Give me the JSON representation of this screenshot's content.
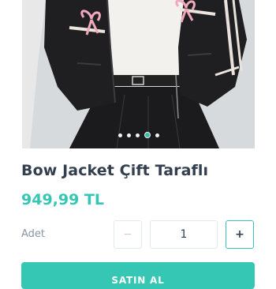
{
  "product": {
    "image_icon": "leather-jacket-photo",
    "gallery_dots": 5,
    "gallery_active_index": 3,
    "title": "Bow Jacket Çift Taraflı",
    "price": "949,99 TL"
  },
  "quantity": {
    "label": "Adet",
    "minus_label": "−",
    "value": "1",
    "plus_label": "+"
  },
  "actions": {
    "buy_label": "SATIN AL"
  },
  "colors": {
    "accent": "#35c7b3",
    "title": "#333e4f",
    "muted": "#8a94a2"
  }
}
